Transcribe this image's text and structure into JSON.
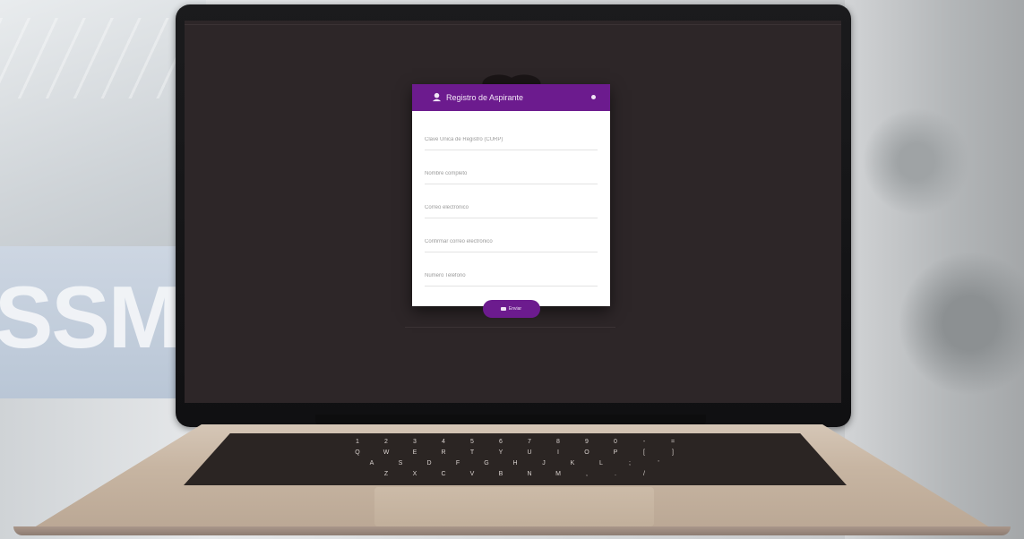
{
  "background": {
    "sign_text": "SSM"
  },
  "modal": {
    "title": "Registro de Aspirante",
    "fields": [
      {
        "placeholder": "Clave Única de Registro (CURP)"
      },
      {
        "placeholder": "Nombre completo"
      },
      {
        "placeholder": "Correo electrónico"
      },
      {
        "placeholder": "Confirmar correo electrónico"
      },
      {
        "placeholder": "Número Teléfono"
      }
    ],
    "submit_label": "Enviar"
  },
  "keyboard": {
    "row1": [
      "1",
      "2",
      "3",
      "4",
      "5",
      "6",
      "7",
      "8",
      "9",
      "0",
      "-",
      "="
    ],
    "row2": [
      "Q",
      "W",
      "E",
      "R",
      "T",
      "Y",
      "U",
      "I",
      "O",
      "P",
      "[",
      "]"
    ],
    "row3": [
      "A",
      "S",
      "D",
      "F",
      "G",
      "H",
      "J",
      "K",
      "L",
      ";",
      "'"
    ],
    "row4": [
      "Z",
      "X",
      "C",
      "V",
      "B",
      "N",
      "M",
      ",",
      ".",
      "/"
    ]
  },
  "colors": {
    "accent": "#6c1b8e",
    "screen_bg": "#2d2628"
  }
}
